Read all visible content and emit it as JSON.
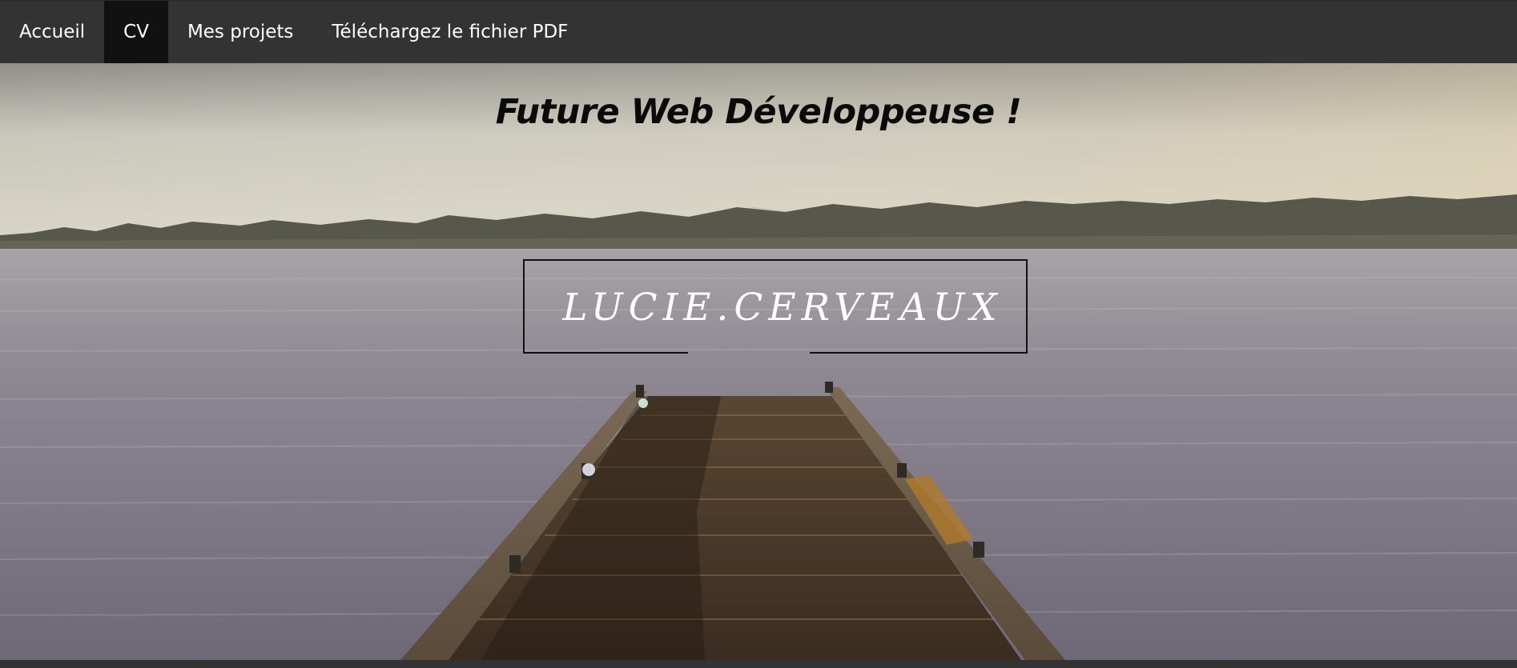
{
  "nav": {
    "items": [
      {
        "label": "Accueil",
        "active": false
      },
      {
        "label": "CV",
        "active": true
      },
      {
        "label": "Mes projets",
        "active": false
      },
      {
        "label": "Téléchargez le fichier PDF",
        "active": false
      }
    ]
  },
  "hero": {
    "title": "Future Web Développeuse !",
    "name": "LUCIE.CERVEAUX",
    "background_scene": "lake-pier-photo"
  },
  "colors": {
    "nav_bg": "#333333",
    "nav_active_bg": "#111111",
    "nav_text": "#ffffff",
    "title_text": "#0a0a0a",
    "name_text": "#ffffff"
  }
}
